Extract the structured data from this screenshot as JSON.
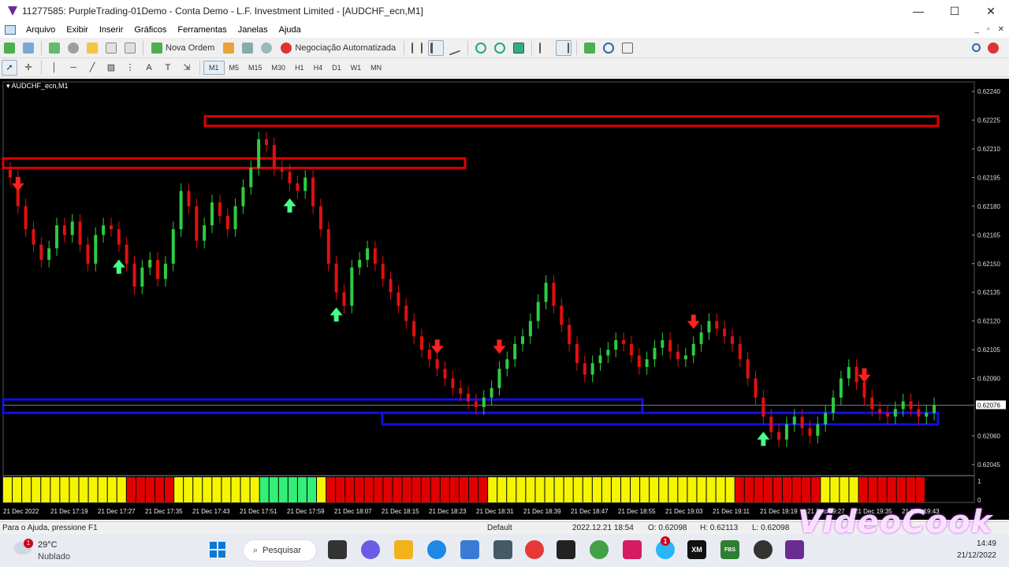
{
  "window": {
    "title": "11277585: PurpleTrading-01Demo - Conta Demo - L.F. Investment Limited - [AUDCHF_ecn,M1]",
    "min_glyph": "—",
    "max_glyph": "☐",
    "close_glyph": "✕"
  },
  "menu": {
    "items": [
      "Arquivo",
      "Exibir",
      "Inserir",
      "Gráficos",
      "Ferramentas",
      "Janelas",
      "Ajuda"
    ],
    "mdi_min": "_",
    "mdi_restore": "▫",
    "mdi_close": "✕"
  },
  "toolbar": {
    "new_order_label": "Nova Ordem",
    "auto_trading_label": "Negociação Automatizada"
  },
  "timeframes": [
    "M1",
    "M5",
    "M15",
    "M30",
    "H1",
    "H4",
    "D1",
    "W1",
    "MN"
  ],
  "active_timeframe": "M1",
  "chart": {
    "symbol_label": "AUDCHF_ecn,M1",
    "price_ticks": [
      "0.62240",
      "0.62225",
      "0.62210",
      "0.62195",
      "0.62180",
      "0.62165",
      "0.62150",
      "0.62135",
      "0.62120",
      "0.62105",
      "0.62090",
      "0.62060",
      "0.62045"
    ],
    "current_price": "0.62076",
    "time_labels": [
      "21 Dec 2022",
      "21 Dec 17:19",
      "21 Dec 17:27",
      "21 Dec 17:35",
      "21 Dec 17:43",
      "21 Dec 17:51",
      "21 Dec 17:59",
      "21 Dec 18:07",
      "21 Dec 18:15",
      "21 Dec 18:23",
      "21 Dec 18:31",
      "21 Dec 18:39",
      "21 Dec 18:47",
      "21 Dec 18:55",
      "21 Dec 19:03",
      "21 Dec 19:11",
      "21 Dec 19:19",
      "21 Dec 19:27",
      "21 Dec 19:35",
      "21 Dec 19:43"
    ],
    "indicator_scale": [
      "1",
      "0"
    ],
    "colors": {
      "bull": "#2ecc40",
      "bear": "#e01010",
      "up_arrow": "#44ff88",
      "down_arrow": "#ff2020",
      "resistance": "#e00000",
      "support": "#1010e0",
      "hist_yellow": "#f5f500",
      "hist_red": "#e00000",
      "hist_green": "#33ee77"
    }
  },
  "chart_data": {
    "type": "candlestick",
    "symbol": "AUDCHF_ecn",
    "timeframe": "M1",
    "ylim": [
      0.6204,
      0.62245
    ],
    "current_price": 0.62076,
    "resistance_zones": [
      [
        0.62222,
        0.62227
      ],
      [
        0.622,
        0.62205
      ]
    ],
    "support_zones": [
      [
        0.62072,
        0.62079
      ],
      [
        0.62066,
        0.62072
      ]
    ],
    "closes": [
      0.62195,
      0.6218,
      0.62168,
      0.6216,
      0.62152,
      0.62158,
      0.6217,
      0.62165,
      0.62172,
      0.6216,
      0.6215,
      0.62165,
      0.6217,
      0.62168,
      0.6216,
      0.6215,
      0.62138,
      0.62148,
      0.62152,
      0.62142,
      0.6215,
      0.62168,
      0.62188,
      0.6218,
      0.62162,
      0.6217,
      0.62182,
      0.62175,
      0.62168,
      0.6218,
      0.6219,
      0.622,
      0.62215,
      0.62212,
      0.622,
      0.62198,
      0.62192,
      0.62188,
      0.62195,
      0.6218,
      0.62168,
      0.6215,
      0.62135,
      0.62128,
      0.62148,
      0.62152,
      0.62158,
      0.6215,
      0.62142,
      0.62135,
      0.62128,
      0.6212,
      0.62112,
      0.62105,
      0.621,
      0.62095,
      0.6209,
      0.62085,
      0.62082,
      0.62078,
      0.62075,
      0.6208,
      0.62085,
      0.62095,
      0.621,
      0.62108,
      0.62112,
      0.6212,
      0.6213,
      0.6214,
      0.62128,
      0.62118,
      0.62108,
      0.62098,
      0.62092,
      0.62098,
      0.62102,
      0.62105,
      0.6211,
      0.62108,
      0.62102,
      0.62096,
      0.621,
      0.62106,
      0.6211,
      0.62104,
      0.621,
      0.62102,
      0.62108,
      0.62114,
      0.6212,
      0.62116,
      0.62112,
      0.62108,
      0.621,
      0.6209,
      0.6208,
      0.6207,
      0.62062,
      0.62058,
      0.62066,
      0.6207,
      0.62064,
      0.6206,
      0.62066,
      0.62072,
      0.6208,
      0.6209,
      0.62096,
      0.62088,
      0.6208,
      0.62074,
      0.62072,
      0.6207,
      0.62074,
      0.62078,
      0.62074,
      0.6207,
      0.62072,
      0.62076
    ],
    "up_arrows_at_index": [
      14,
      36,
      42,
      97
    ],
    "down_arrows_at_index": [
      1,
      55,
      63,
      88,
      110
    ],
    "indicator_histogram": {
      "type": "color-bars",
      "segments": [
        {
          "color": "yellow",
          "from": 0,
          "to": 13
        },
        {
          "color": "red",
          "from": 13,
          "to": 18
        },
        {
          "color": "yellow",
          "from": 18,
          "to": 27
        },
        {
          "color": "green",
          "from": 27,
          "to": 33
        },
        {
          "color": "yellow",
          "from": 33,
          "to": 34
        },
        {
          "color": "red",
          "from": 34,
          "to": 51
        },
        {
          "color": "yellow",
          "from": 51,
          "to": 77
        },
        {
          "color": "red",
          "from": 77,
          "to": 86
        },
        {
          "color": "yellow",
          "from": 86,
          "to": 90
        },
        {
          "color": "red",
          "from": 90,
          "to": 97
        }
      ]
    }
  },
  "status": {
    "help": "Para o Ajuda, pressione F1",
    "profile": "Default",
    "datetime": "2022.12.21 18:54",
    "open": "O: 0.62098",
    "high": "H: 0.62113",
    "low": "L: 0.62098"
  },
  "taskbar": {
    "weather_temp": "29°C",
    "weather_cond": "Nublado",
    "weather_badge": "1",
    "search_label": "Pesquisar",
    "time": "14:49",
    "date": "21/12/2022",
    "xm_label": "XM",
    "fbs_label": "FBS",
    "app_badge": "1"
  },
  "watermark": "VideoCook"
}
